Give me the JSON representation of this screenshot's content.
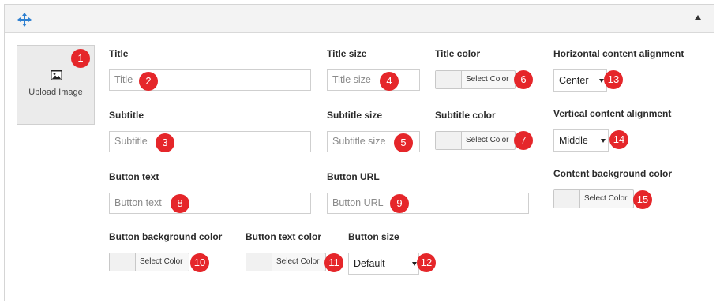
{
  "upload": {
    "label": "Upload Image"
  },
  "fields": {
    "title": {
      "label": "Title",
      "placeholder": "Title"
    },
    "title_size": {
      "label": "Title size",
      "placeholder": "Title size"
    },
    "title_color": {
      "label": "Title color",
      "button": "Select Color"
    },
    "subtitle": {
      "label": "Subtitle",
      "placeholder": "Subtitle"
    },
    "subtitle_size": {
      "label": "Subtitle size",
      "placeholder": "Subtitle size"
    },
    "subtitle_color": {
      "label": "Subtitle color",
      "button": "Select Color"
    },
    "button_text": {
      "label": "Button text",
      "placeholder": "Button text"
    },
    "button_url": {
      "label": "Button URL",
      "placeholder": "Button URL"
    },
    "button_bg_color": {
      "label": "Button background color",
      "button": "Select Color"
    },
    "button_text_color": {
      "label": "Button text color",
      "button": "Select Color"
    },
    "button_size": {
      "label": "Button size",
      "value": "Default"
    },
    "horizontal_alignment": {
      "label": "Horizontal content alignment",
      "value": "Center"
    },
    "vertical_alignment": {
      "label": "Vertical content alignment",
      "value": "Middle"
    },
    "content_bg_color": {
      "label": "Content background color",
      "button": "Select Color"
    }
  },
  "badges": [
    "1",
    "2",
    "3",
    "4",
    "5",
    "6",
    "7",
    "8",
    "9",
    "10",
    "11",
    "12",
    "13",
    "14",
    "15"
  ],
  "colors": {
    "badge": "#e5262a",
    "move_icon": "#2d7fd0"
  },
  "icons": {
    "move": "move-icon",
    "collapse": "collapse-arrow-icon",
    "image": "image-icon"
  }
}
